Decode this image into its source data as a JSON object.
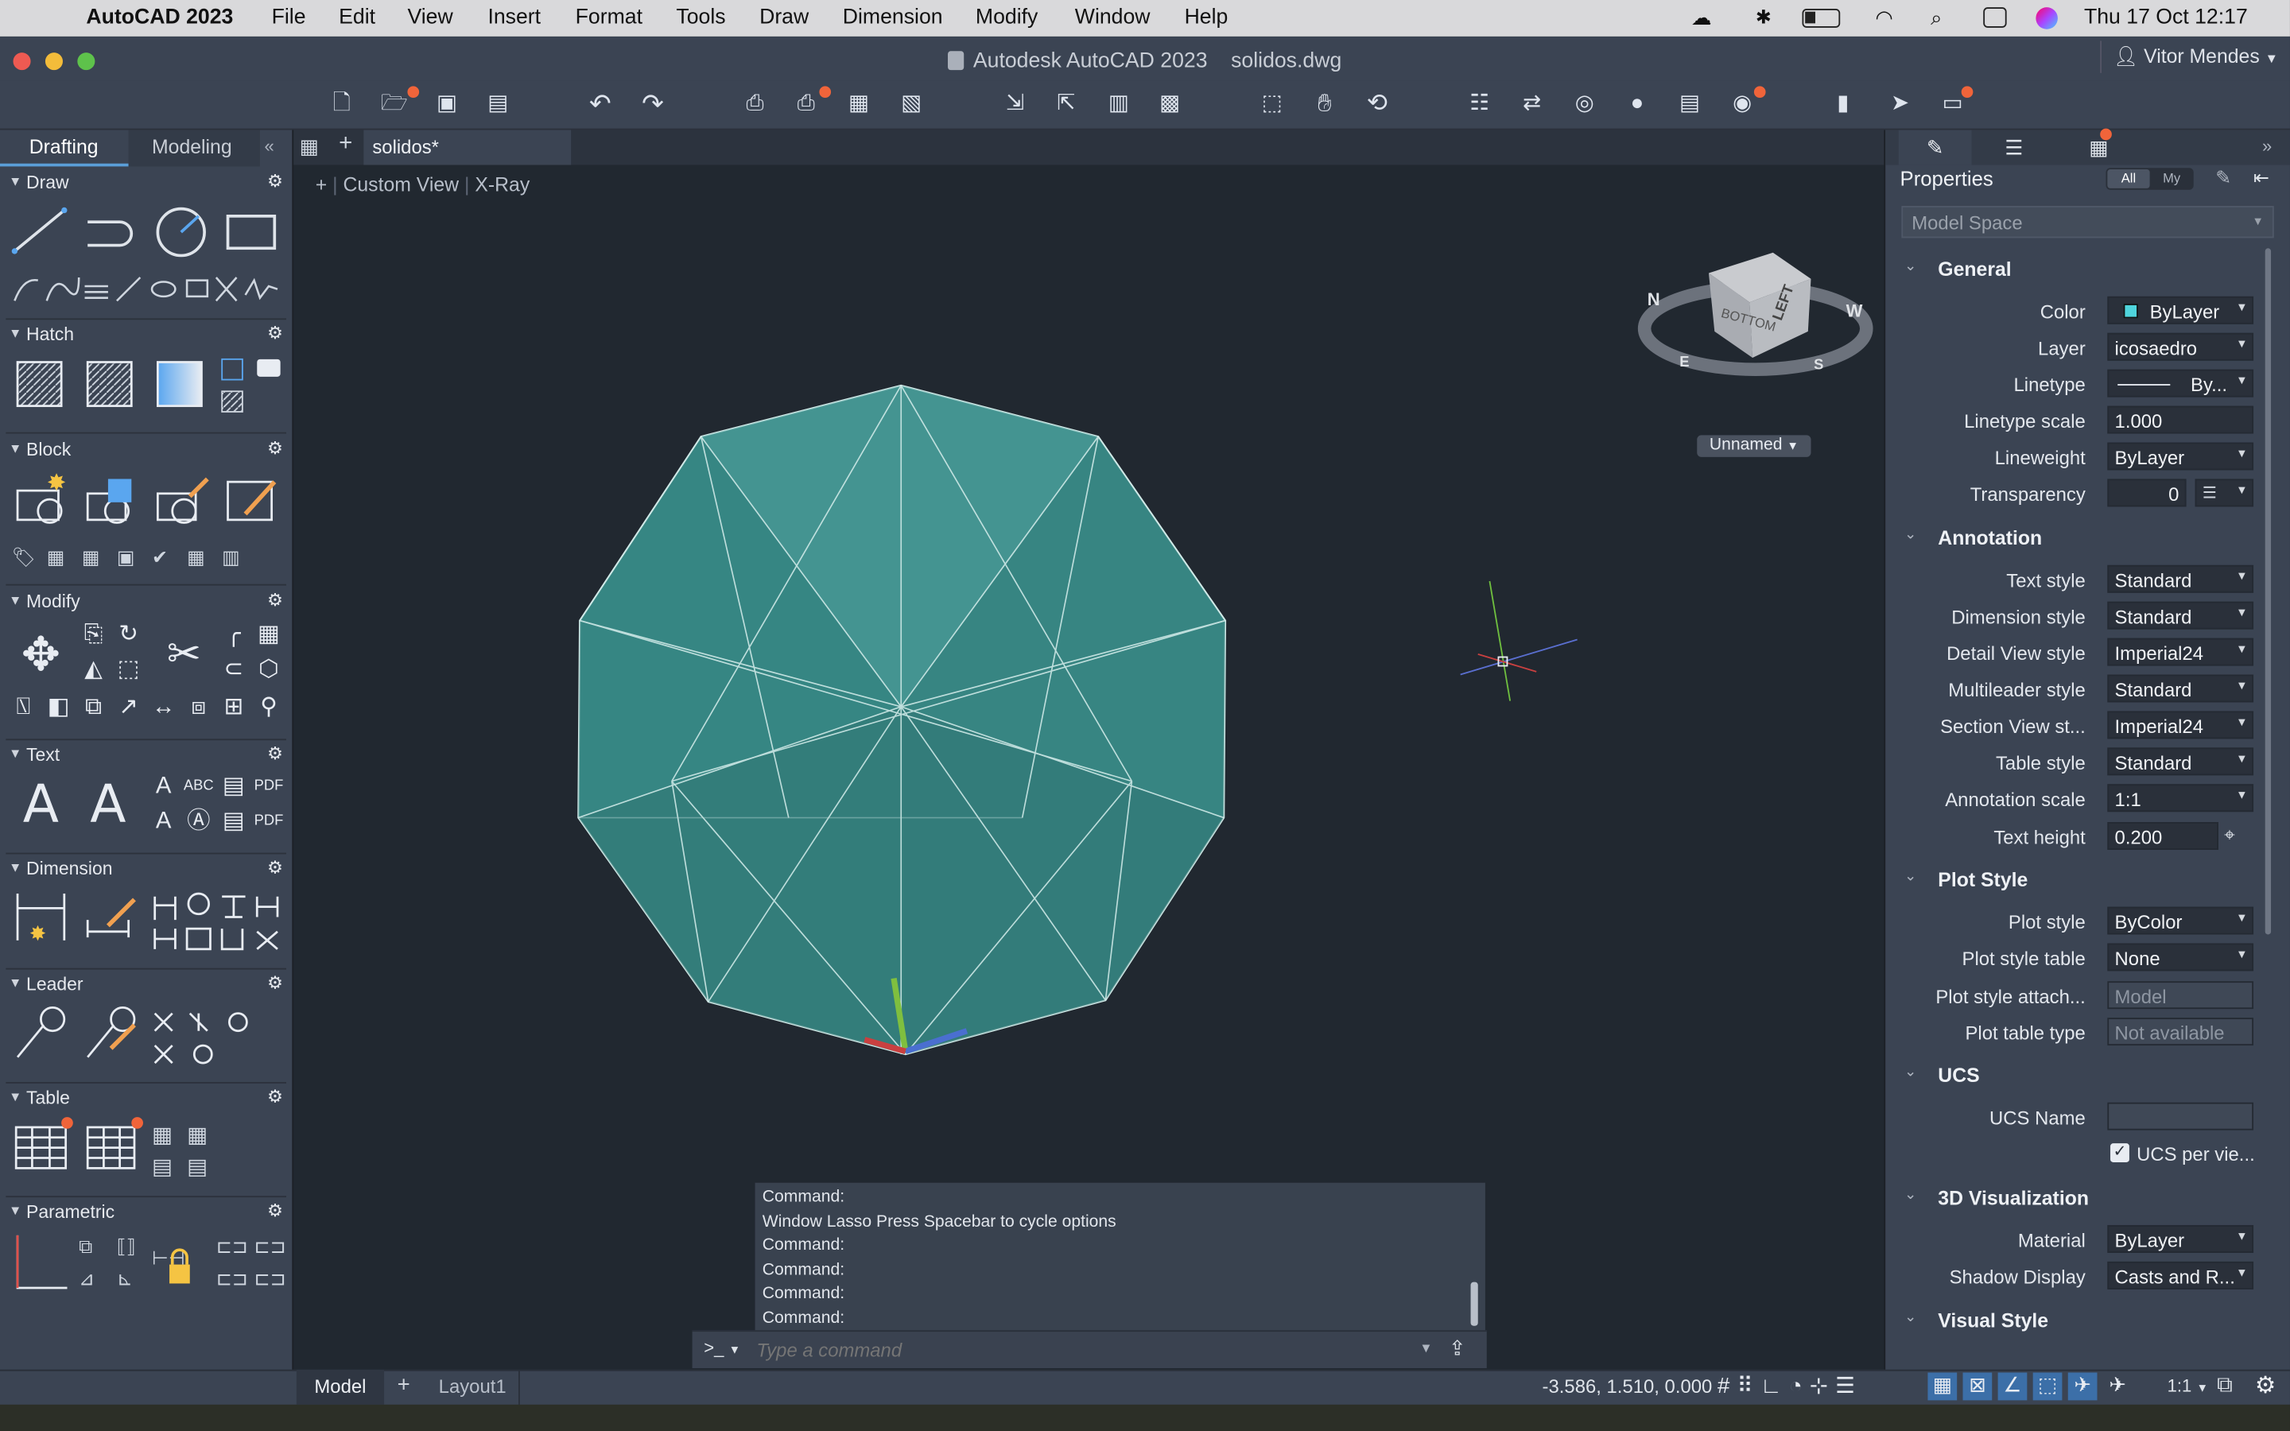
{
  "menubar": {
    "app": "AutoCAD 2023",
    "items": [
      "File",
      "Edit",
      "View",
      "Insert",
      "Format",
      "Tools",
      "Draw",
      "Dimension",
      "Modify",
      "Window",
      "Help"
    ],
    "datetime": "Thu 17 Oct  12:17"
  },
  "window": {
    "title": "Autodesk AutoCAD 2023    solidos.dwg",
    "user": "Vitor Mendes"
  },
  "palette": {
    "tabs": [
      "Drafting",
      "Modeling"
    ],
    "sections": {
      "draw": "Draw",
      "hatch": "Hatch",
      "block": "Block",
      "modify": "Modify",
      "text": "Text",
      "dimension": "Dimension",
      "leader": "Leader",
      "table": "Table",
      "parametric": "Parametric"
    }
  },
  "doc": {
    "tab": "solidos*",
    "view_label": "Custom View",
    "style_label": "X-Ray",
    "viewcube_labels": [
      "LEFT",
      "BOTTOM",
      "W",
      "N",
      "S",
      "E"
    ],
    "named_view": "Unnamed"
  },
  "properties": {
    "title": "Properties",
    "filter_all": "All",
    "filter_my": "My",
    "selector": "Model Space",
    "categories": {
      "general": "General",
      "annotation": "Annotation",
      "plot_style": "Plot Style",
      "ucs": "UCS",
      "viz3d": "3D Visualization",
      "visual_style": "Visual Style"
    },
    "general": [
      {
        "label": "Color",
        "value": "ByLayer"
      },
      {
        "label": "Layer",
        "value": "icosaedro"
      },
      {
        "label": "Linetype",
        "value": "By..."
      },
      {
        "label": "Linetype scale",
        "value": "1.000"
      },
      {
        "label": "Lineweight",
        "value": "ByLayer"
      },
      {
        "label": "Transparency",
        "value": "0"
      }
    ],
    "annotation": [
      {
        "label": "Text style",
        "value": "Standard"
      },
      {
        "label": "Dimension style",
        "value": "Standard"
      },
      {
        "label": "Detail View style",
        "value": "Imperial24"
      },
      {
        "label": "Multileader style",
        "value": "Standard"
      },
      {
        "label": "Section View st...",
        "value": "Imperial24"
      },
      {
        "label": "Table style",
        "value": "Standard"
      },
      {
        "label": "Annotation scale",
        "value": "1:1"
      },
      {
        "label": "Text height",
        "value": "0.200"
      }
    ],
    "plot_style": [
      {
        "label": "Plot style",
        "value": "ByColor"
      },
      {
        "label": "Plot style table",
        "value": "None"
      },
      {
        "label": "Plot style attach...",
        "value": "Model"
      },
      {
        "label": "Plot table type",
        "value": "Not available"
      }
    ],
    "ucs": [
      {
        "label": "UCS Name",
        "value": ""
      },
      {
        "label": "",
        "value": "UCS per vie..."
      }
    ],
    "viz3d": [
      {
        "label": "Material",
        "value": "ByLayer"
      },
      {
        "label": "Shadow Display",
        "value": "Casts and R..."
      }
    ]
  },
  "command": {
    "history": [
      "Command:",
      "Window Lasso  Press Spacebar to cycle options",
      "Command:",
      "Command:",
      "Command:",
      "Command:"
    ],
    "prompt": ">_",
    "placeholder": "Type a command"
  },
  "status": {
    "model_tab": "Model",
    "layout_tab": "Layout1",
    "coords": "-3.586, 1.510, 0.000",
    "scale": "1:1"
  },
  "colors": {
    "accent_dot": "#f0643a",
    "solid_fill": "#3d8d8a",
    "viewport_bg": "#212830",
    "panel_bg": "#3b4453"
  }
}
